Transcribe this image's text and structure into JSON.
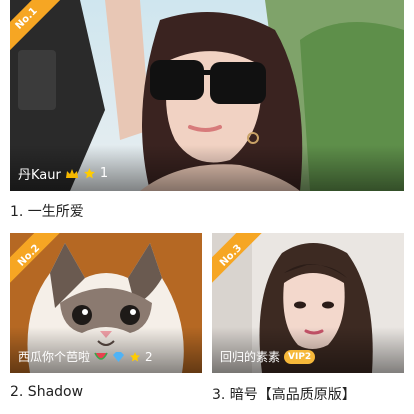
{
  "items": [
    {
      "rank_label": "No.1",
      "name": "丹Kaur",
      "stars": "1",
      "title": "1. 一生所爱",
      "crown": "crown-icon",
      "star": "star-icon"
    },
    {
      "rank_label": "No.2",
      "name": "西瓜你个芭啦",
      "stars": "2",
      "title": "2. Shadow",
      "crown": "watermelon-icon",
      "star": "star-icon",
      "gem": "diamond-icon"
    },
    {
      "rank_label": "No.3",
      "name": "回归的素素",
      "vip": "VIP2",
      "title": "3. 暗号【高品质原版】"
    }
  ],
  "colors": {
    "ribbon": "#f6a623",
    "star": "#ffcc00",
    "diamond": "#4fb3f6",
    "vip": "#f6b83a"
  }
}
